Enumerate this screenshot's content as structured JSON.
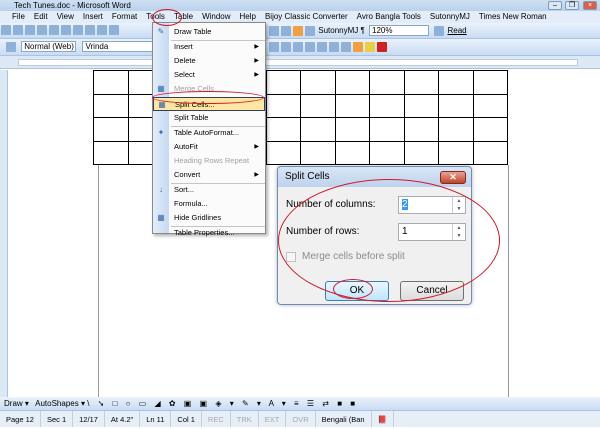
{
  "window": {
    "title": "Tech Tunes.doc - Microsoft Word"
  },
  "menubar": [
    "File",
    "Edit",
    "View",
    "Insert",
    "Format",
    "Tools",
    "Table",
    "Window",
    "Help",
    "Bijoy Classic Converter",
    "Avro Bangla Tools",
    "SutonnyMJ",
    "Times New Roman"
  ],
  "toolbar": {
    "font_name": "SutonnyMJ",
    "zoom": "120%",
    "read_label": "Read",
    "style": "Normal (Web)",
    "font": "Vrinda"
  },
  "table_menu": [
    {
      "label": "Draw Table",
      "icon": "pencil-icon"
    },
    {
      "label": "Insert",
      "submenu": true
    },
    {
      "label": "Delete",
      "submenu": true
    },
    {
      "label": "Select",
      "submenu": true
    },
    {
      "label": "Merge Cells",
      "disabled": true,
      "icon": "merge-icon"
    },
    {
      "label": "Split Cells...",
      "highlighted": true,
      "icon": "split-icon"
    },
    {
      "label": "Split Table"
    },
    {
      "label": "Table AutoFormat...",
      "icon": "autoformat-icon"
    },
    {
      "label": "AutoFit",
      "submenu": true
    },
    {
      "label": "Heading Rows Repeat",
      "disabled": true
    },
    {
      "label": "Convert",
      "submenu": true
    },
    {
      "label": "Sort...",
      "icon": "sort-icon"
    },
    {
      "label": "Formula..."
    },
    {
      "label": "Hide Gridlines",
      "icon": "gridlines-icon"
    },
    {
      "label": "Table Properties..."
    }
  ],
  "dialog": {
    "title": "Split Cells",
    "columns_label": "Number of columns:",
    "columns_value": "2",
    "rows_label": "Number of rows:",
    "rows_value": "1",
    "merge_label": "Merge cells before split",
    "ok": "OK",
    "cancel": "Cancel"
  },
  "draw_toolbar": {
    "draw": "Draw",
    "autoshapes": "AutoShapes"
  },
  "status": {
    "page": "Page 12",
    "sec": "Sec 1",
    "pages": "12/17",
    "at": "At 4.2\"",
    "ln": "Ln 11",
    "col": "Col 1",
    "rec": "REC",
    "trk": "TRK",
    "ext": "EXT",
    "ovr": "OVR",
    "lang": "Bengali (Ban"
  },
  "colors": {
    "highlight_ring": "#d01a2a",
    "menu_highlight": "#ffe7a2"
  }
}
